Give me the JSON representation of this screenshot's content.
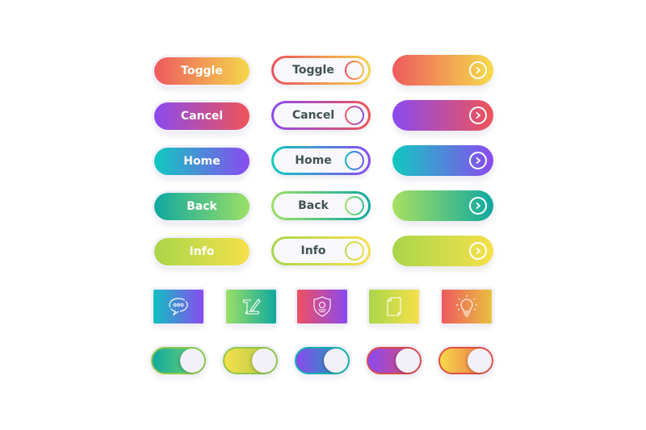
{
  "filled_buttons": [
    {
      "label": "Toggle",
      "gradient": [
        "#ee5a5e",
        "#f4d74a"
      ]
    },
    {
      "label": "Cancel",
      "gradient": [
        "#8a4af0",
        "#ef5457"
      ]
    },
    {
      "label": "Home",
      "gradient": [
        "#10c9c0",
        "#8a4af0"
      ]
    },
    {
      "label": "Back",
      "gradient": [
        "#10a8a0",
        "#9be065"
      ]
    },
    {
      "label": "Info",
      "gradient": [
        "#a8d64a",
        "#f6e04a"
      ]
    }
  ],
  "outlined_buttons": [
    {
      "label": "Toggle",
      "border_gradient": [
        "#ee4f5a",
        "#f4d74a"
      ],
      "ring_gradient": [
        "#ee4f5a",
        "#f4c14a"
      ],
      "text_color": "#3f5350"
    },
    {
      "label": "Cancel",
      "border_gradient": [
        "#8a4af0",
        "#ef5457"
      ],
      "ring_gradient": [
        "#ef5457",
        "#8a4af0"
      ],
      "text_color": "#3f5350"
    },
    {
      "label": "Home",
      "border_gradient": [
        "#10c9c0",
        "#8a4af0"
      ],
      "ring_gradient": [
        "#10b0c9",
        "#6a5af0"
      ],
      "text_color": "#3f5350"
    },
    {
      "label": "Back",
      "border_gradient": [
        "#9be065",
        "#10a8a0"
      ],
      "ring_gradient": [
        "#9be065",
        "#30c090"
      ],
      "text_color": "#3f5350"
    },
    {
      "label": "Info",
      "border_gradient": [
        "#a8d64a",
        "#f6e04a"
      ],
      "ring_gradient": [
        "#c0d84a",
        "#f0e04a"
      ],
      "text_color": "#3f5350"
    }
  ],
  "arrow_buttons": [
    {
      "icon": "chevron-right-circle-icon",
      "gradient": [
        "#ee5a5e",
        "#f6dc4a"
      ]
    },
    {
      "icon": "chevron-right-circle-icon",
      "gradient": [
        "#8a4af0",
        "#ef5457"
      ]
    },
    {
      "icon": "chevron-right-circle-icon",
      "gradient": [
        "#10c9c0",
        "#8a4af0"
      ]
    },
    {
      "icon": "chevron-right-circle-icon",
      "gradient": [
        "#a8e060",
        "#10a8a0"
      ]
    },
    {
      "icon": "chevron-right-circle-icon",
      "gradient": [
        "#a8d64a",
        "#f6e04a"
      ]
    }
  ],
  "icon_tiles": [
    {
      "icon": "chat-bubble-icon",
      "gradient": [
        "#10c0c0",
        "#8a4af0"
      ]
    },
    {
      "icon": "scroll-pencil-icon",
      "gradient": [
        "#9be065",
        "#10a8a0"
      ]
    },
    {
      "icon": "shield-user-icon",
      "gradient": [
        "#ef5060",
        "#8a4af0"
      ]
    },
    {
      "icon": "document-icon",
      "gradient": [
        "#a8d64a",
        "#f6e04a"
      ]
    },
    {
      "icon": "lightbulb-icon",
      "gradient": [
        "#ee5a5e",
        "#e8c040"
      ]
    }
  ],
  "toggles": [
    {
      "state": "on",
      "gradient": [
        "#10a8a0",
        "#7ad86a"
      ],
      "border": "#8cc84a"
    },
    {
      "state": "on",
      "gradient": [
        "#f6e04a",
        "#a8c84a"
      ],
      "border": "#8cc84a"
    },
    {
      "state": "on",
      "gradient": [
        "#8a4af0",
        "#10a8b0"
      ],
      "border": "#10b0a8"
    },
    {
      "state": "on",
      "gradient": [
        "#8a4af0",
        "#e04a6a"
      ],
      "border": "#d84a4a"
    },
    {
      "state": "on",
      "gradient": [
        "#f6d84a",
        "#ee6a4a"
      ],
      "border": "#e05040"
    }
  ]
}
